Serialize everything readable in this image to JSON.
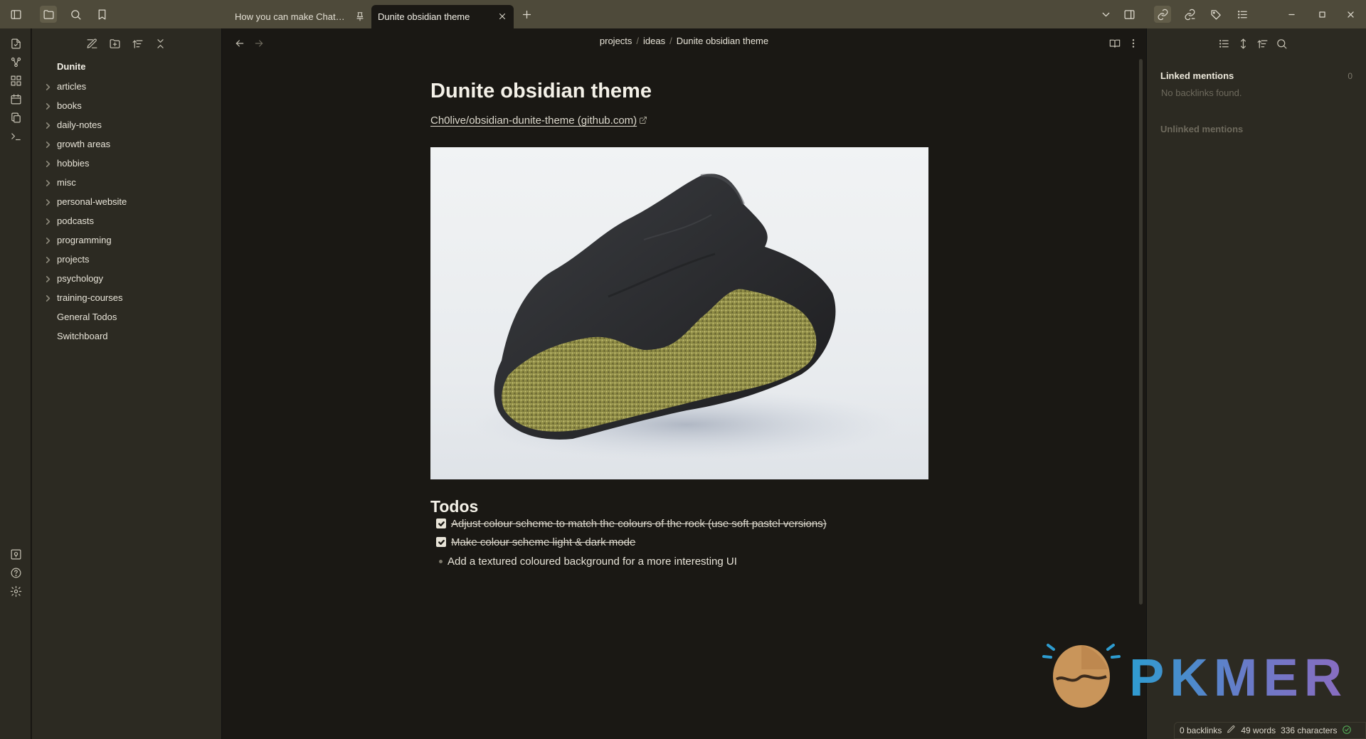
{
  "tabs": [
    {
      "title": "How you can make ChatG...",
      "pinned": true,
      "active": false
    },
    {
      "title": "Dunite obsidian theme",
      "active": true
    }
  ],
  "breadcrumb": [
    "projects",
    "ideas",
    "Dunite obsidian theme"
  ],
  "explorer": {
    "vault_name": "Dunite",
    "folders": [
      "articles",
      "books",
      "daily-notes",
      "growth areas",
      "hobbies",
      "misc",
      "personal-website",
      "podcasts",
      "programming",
      "projects",
      "psychology",
      "training-courses"
    ],
    "files": [
      "General Todos",
      "Switchboard"
    ]
  },
  "note": {
    "title": "Dunite obsidian theme",
    "link_text": "Ch0live/obsidian-dunite-theme (github.com)",
    "image_subject": "dunite rock specimen",
    "todos_heading": "Todos",
    "tasks": [
      {
        "text": "Adjust colour scheme to match the colours of the rock (use soft pastel versions)",
        "done": true
      },
      {
        "text": "Make colour scheme light & dark mode",
        "done": true
      }
    ],
    "bullet": "Add a textured coloured background for a more interesting UI"
  },
  "backlinks": {
    "linked_title": "Linked mentions",
    "linked_count": "0",
    "empty_text": "No backlinks found.",
    "unlinked_title": "Unlinked mentions"
  },
  "status": {
    "backlinks": "0 backlinks",
    "words": "49 words",
    "characters": "336 characters"
  },
  "watermark": "PKMER",
  "colors": {
    "titlebar": "#4e4a3a",
    "sidebar": "#2c2a22",
    "editor": "#1a1814",
    "accent_watermark": "#2e9cd0"
  }
}
